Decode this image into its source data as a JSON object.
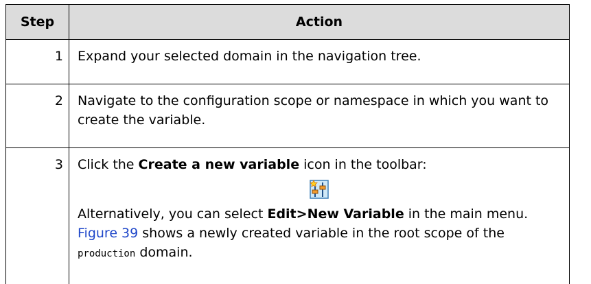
{
  "table": {
    "headers": {
      "step": "Step",
      "action": "Action"
    },
    "rows": [
      {
        "step": "1",
        "text": "Expand your selected domain in the navigation tree."
      },
      {
        "step": "2",
        "text": "Navigate to the configuration scope or namespace in which you want to create the variable."
      },
      {
        "step": "3",
        "p1_before": "Click the ",
        "p1_bold": "Create a new variable",
        "p1_after": " icon in the toolbar:",
        "icon": "create-variable-icon",
        "p2_before": "Alternatively, you can select ",
        "p2_bold": "Edit>New Variable",
        "p2_mid": " in the main menu. ",
        "p2_link": "Figure 39",
        "p2_after": " shows a newly created variable in the root scope of the ",
        "p2_code": "production",
        "p2_end": " domain."
      }
    ]
  },
  "colors": {
    "header_bg": "#dcdcdc",
    "link": "#1f47c9",
    "border": "#000000"
  }
}
